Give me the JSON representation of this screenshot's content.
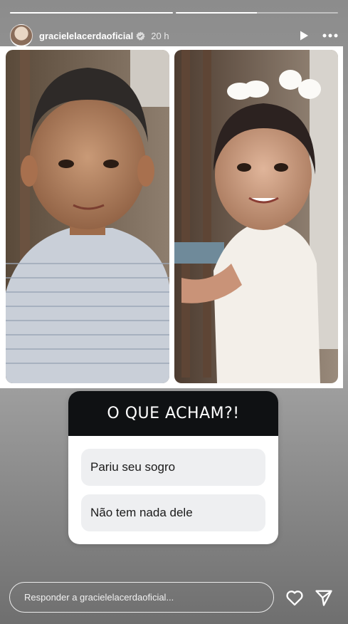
{
  "story": {
    "progress": [
      1,
      0.5
    ],
    "username": "gracielelacerdaoficial",
    "time": "20 h",
    "icons": {
      "verified": "verified-badge-icon",
      "play": "play-icon",
      "more": "more-options-icon"
    }
  },
  "poll": {
    "question": "O QUE ACHAM?!",
    "options": [
      "Pariu seu sogro",
      "Não tem nada dele"
    ]
  },
  "reply": {
    "placeholder": "Responder a gracielelacerdaoficial..."
  },
  "actions": {
    "like": "heart-icon",
    "share": "send-icon"
  }
}
